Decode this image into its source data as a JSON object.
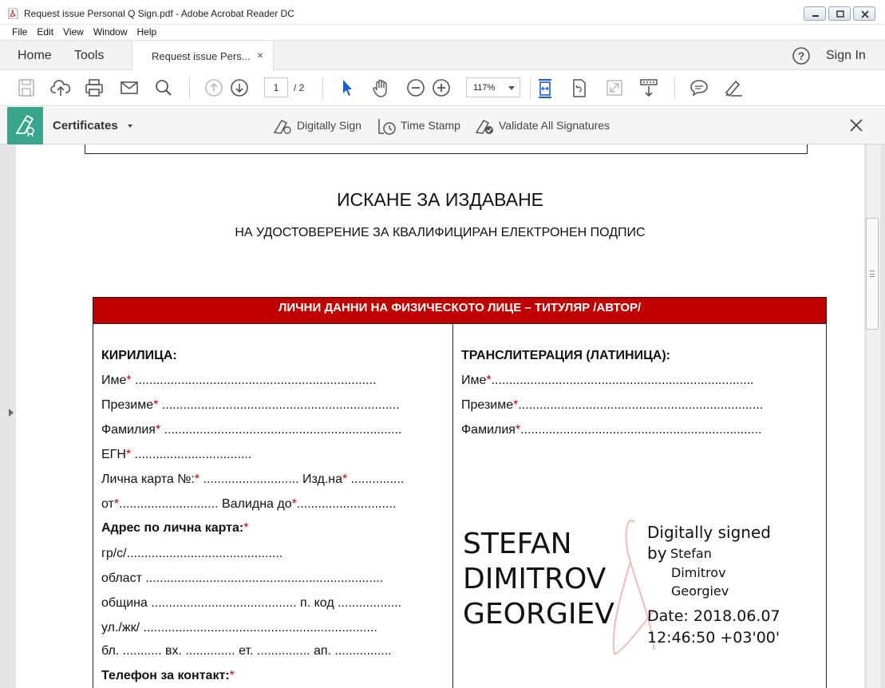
{
  "window": {
    "title": "Request issue Personal Q Sign.pdf - Adobe Acrobat Reader DC",
    "controls": [
      "minimize",
      "restore",
      "close"
    ]
  },
  "menu": [
    "File",
    "Edit",
    "View",
    "Window",
    "Help"
  ],
  "tabs": {
    "home": "Home",
    "tools": "Tools",
    "document_tab": "Request issue Pers...",
    "close_glyph": "×",
    "sign_in": "Sign In"
  },
  "toolbar": {
    "page_current": "1",
    "page_total": "/ 2",
    "zoom": "117%",
    "icons": [
      "save-icon",
      "upload-cloud-icon",
      "print-icon",
      "email-icon",
      "search-icon",
      "page-up-icon",
      "page-down-icon",
      "select-cursor-icon",
      "hand-icon",
      "zoom-out-icon",
      "zoom-in-icon",
      "fit-width-icon",
      "rotate-page-icon",
      "full-screen-icon",
      "scroll-mode-icon",
      "comment-icon",
      "highlight-pen-icon"
    ]
  },
  "certificates": {
    "title": "Certificates",
    "actions": {
      "digitally_sign": "Digitally Sign",
      "time_stamp": "Time Stamp",
      "validate_all": "Validate All Signatures"
    }
  },
  "document": {
    "top_fragment": "·  ·  ·  | ·  ·  ·",
    "title": "ИСКАНЕ ЗА ИЗДАВАНЕ",
    "subtitle": "НА УДОСТОВЕРЕНИЕ ЗА КВАЛИФИЦИРАН ЕЛЕКТРОНЕН ПОДПИС",
    "section_header": "ЛИЧНИ ДАННИ НА ФИЗИЧЕСКОТО ЛИЦЕ – ТИТУЛЯР /АВТОР/",
    "left": {
      "heading": "КИРИЛИЦА:",
      "name": "Име",
      "name_dots": " ....................................................................",
      "middle": "Презиме",
      "middle_dots": " ...................................................................",
      "surname": "Фамилия",
      "surname_dots": " ...................................................................",
      "egn": "ЕГН",
      "egn_dots": " .................................",
      "id_card": "Лична карта №:",
      "id_card_dots": " ........................... Изд.на",
      "id_card_dots2": " ...............",
      "from": "от",
      "from_dots": "............................ Валидна до",
      "valid_dots": "............................",
      "address": "Адрес по лична карта:",
      "city": "гр/с/............................................",
      "region": "област ...................................................................",
      "municipality": "община  ......................................... п. код ..................",
      "street": "ул./жк/ ..................................................................",
      "block": "бл. ........... вх. .............. ет. ............... ап. ................",
      "phone": "Телефон за контакт:"
    },
    "right": {
      "heading": "ТРАНСЛИТЕРАЦИЯ (ЛАТИНИЦА):",
      "name": "Име",
      "name_dots": "..........................................................................",
      "middle": "Презиме",
      "middle_dots": ".....................................................................",
      "surname": "Фамилия",
      "surname_dots": "...................................................................."
    },
    "required_mark": "*",
    "signature": {
      "name_line1": "STEFAN",
      "name_line2": "DIMITROV",
      "name_line3": "GEORGIEV",
      "signed_label": "Digitally signed",
      "by": "by",
      "by_name1": "Stefan",
      "by_name2": "Dimitrov",
      "by_name3": "Georgiev",
      "date": "Date: 2018.06.07",
      "time": "12:46:50 +03'00'"
    }
  },
  "colors": {
    "cert_badge": "#39a58a",
    "section_header_bg": "#c00000",
    "required": "#c00000",
    "select_cursor": "#1a5dd6"
  }
}
